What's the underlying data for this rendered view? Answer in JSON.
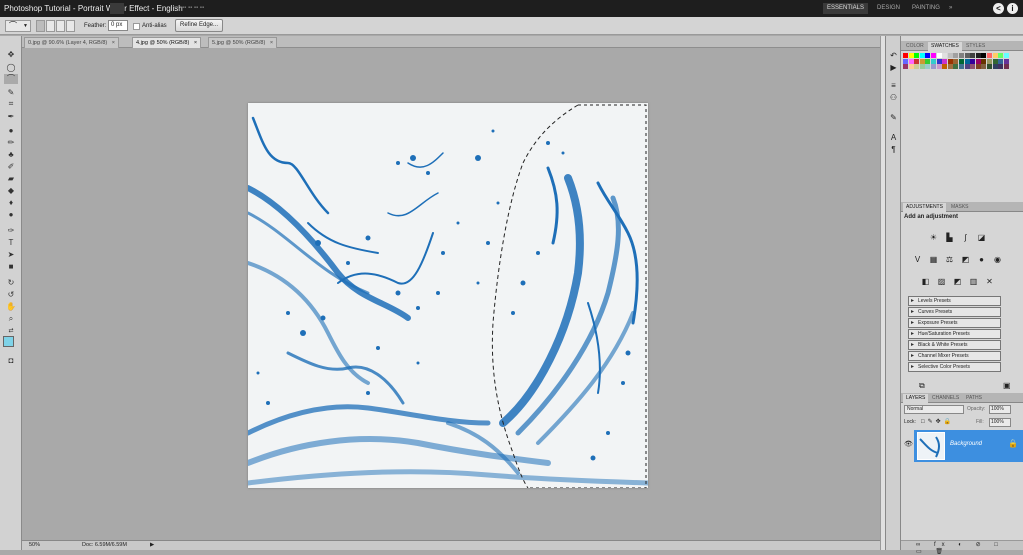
{
  "titlebar": {
    "title": "Photoshop Tutorial - Portrait Water Effect - English",
    "workspaces": [
      "ESSENTIALS",
      "DESIGN",
      "PAINTING"
    ]
  },
  "options": {
    "feather_label": "Feather:",
    "feather_value": "0 px",
    "antialias_label": "Anti-alias",
    "refine_edge_label": "Refine Edge..."
  },
  "doc_tabs": [
    {
      "label": "0.jpg @ 90.6% (Layer 4, RGB/8)"
    },
    {
      "label": "4.jpg @ 50% (RGB/8)"
    },
    {
      "label": "5.jpg @ 50% (RGB/8)"
    }
  ],
  "status": {
    "zoom": "50%",
    "doc_size": "Doc: 6.59M/6.59M"
  },
  "color_panel": {
    "tabs": [
      "COLOR",
      "SWATCHES",
      "STYLES"
    ],
    "swatch_colors": [
      "#ff0000",
      "#ffff00",
      "#00ff00",
      "#00ffff",
      "#0000ff",
      "#ff00ff",
      "#ffffff",
      "#e0e0e0",
      "#c0c0c0",
      "#a0a0a0",
      "#808080",
      "#606060",
      "#404040",
      "#202020",
      "#000000",
      "#ff6666",
      "#ffcc66",
      "#66ff66",
      "#66ffff",
      "#6666ff",
      "#ff66ff",
      "#cc3333",
      "#cc9933",
      "#33cc33",
      "#33cccc",
      "#3333cc",
      "#cc33cc",
      "#993300",
      "#996633",
      "#006633",
      "#006699",
      "#330099",
      "#990066",
      "#663300",
      "#999966",
      "#336633",
      "#336699",
      "#663399",
      "#993366",
      "#ffcc99",
      "#cccc99",
      "#99cc99",
      "#99cccc",
      "#9999cc",
      "#cc99cc",
      "#c06000",
      "#a07040",
      "#407040",
      "#407090",
      "#504080",
      "#905070",
      "#804020",
      "#806040",
      "#305030",
      "#304060",
      "#403060",
      "#703050"
    ]
  },
  "adjustments_panel": {
    "tabs": [
      "ADJUSTMENTS",
      "MASKS"
    ],
    "heading": "Add an adjustment",
    "presets": [
      "Levels Presets",
      "Curves Presets",
      "Exposure Presets",
      "Hue/Saturation Presets",
      "Black & White Presets",
      "Channel Mixer Presets",
      "Selective Color Presets"
    ]
  },
  "layers_panel": {
    "tabs": [
      "LAYERS",
      "CHANNELS",
      "PATHS"
    ],
    "blend_mode": "Normal",
    "opacity_label": "Opacity:",
    "opacity_value": "100%",
    "lock_label": "Lock:",
    "fill_label": "Fill:",
    "fill_value": "100%",
    "layer_name": "Background"
  },
  "colors": {
    "titlebar_bg": "#1e1e1e",
    "layer_selected": "#3d8fe0",
    "water_blue": "#1e6fb8",
    "foreground_color": "#7fd3e8"
  }
}
